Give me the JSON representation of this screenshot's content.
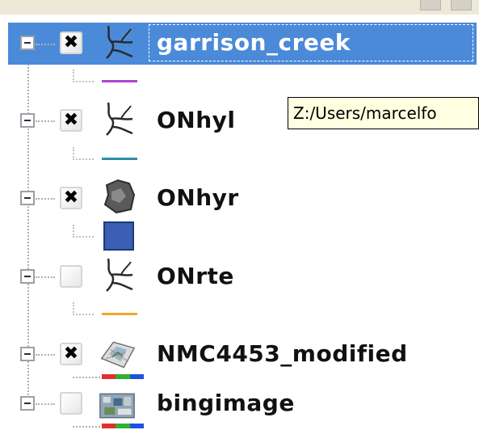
{
  "layers": [
    {
      "name": "garrison_creek",
      "checked": true,
      "selected": true,
      "icon": "river-network-icon",
      "legend": {
        "kind": "line",
        "color": "#b043d0"
      }
    },
    {
      "name": "ONhyl",
      "checked": true,
      "selected": false,
      "icon": "river-network-icon",
      "legend": {
        "kind": "line",
        "color": "#2f8da8"
      }
    },
    {
      "name": "ONhyr",
      "checked": true,
      "selected": false,
      "icon": "polygon-shape-icon",
      "legend": {
        "kind": "fill",
        "color": "#3a5fb3"
      }
    },
    {
      "name": "ONrte",
      "checked": false,
      "selected": false,
      "icon": "river-network-icon",
      "legend": {
        "kind": "line",
        "color": "#f0a830"
      }
    },
    {
      "name": "NMC4453_modified",
      "checked": true,
      "selected": false,
      "icon": "raster-map-icon",
      "legend": {
        "kind": "rgb",
        "colors": [
          "#e03030",
          "#30b030",
          "#2050e0"
        ]
      }
    },
    {
      "name": "bingimage",
      "checked": false,
      "selected": false,
      "icon": "aerial-image-icon",
      "legend": {
        "kind": "rgb",
        "colors": [
          "#e03030",
          "#30b030",
          "#2050e0"
        ]
      }
    }
  ],
  "checkmark_glyph": "✖",
  "tooltip": {
    "text": "Z:/Users/marcelfo"
  },
  "colors": {
    "selection": "#4b8ad8",
    "tooltip_bg": "#ffffe1"
  }
}
